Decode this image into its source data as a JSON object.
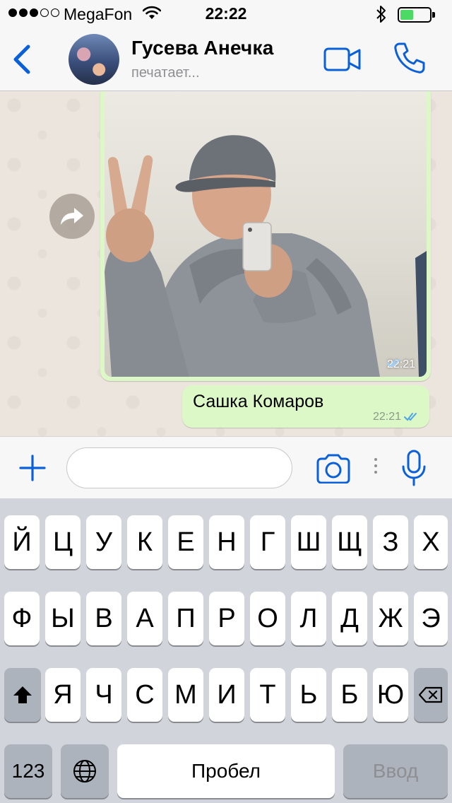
{
  "status_bar": {
    "carrier": "MegaFon",
    "time": "22:22",
    "signal_bars_filled": 3,
    "signal_bars_total": 5,
    "battery_level": 0.45,
    "battery_color": "#4cd964"
  },
  "header": {
    "contact_name": "Гусева Анечка",
    "contact_status": "печатает...",
    "accent_color": "#0a60d8"
  },
  "messages": [
    {
      "type": "image",
      "time": "22:21",
      "status": "read"
    },
    {
      "type": "text",
      "text": "Сашка Комаров",
      "time": "22:21",
      "status": "read"
    }
  ],
  "composer": {
    "placeholder": ""
  },
  "keyboard": {
    "row1": [
      "Й",
      "Ц",
      "У",
      "К",
      "Е",
      "Н",
      "Г",
      "Ш",
      "Щ",
      "З",
      "Х"
    ],
    "row2": [
      "Ф",
      "Ы",
      "В",
      "А",
      "П",
      "Р",
      "О",
      "Л",
      "Д",
      "Ж",
      "Э"
    ],
    "row3": [
      "Я",
      "Ч",
      "С",
      "М",
      "И",
      "Т",
      "Ь",
      "Б",
      "Ю"
    ],
    "numbers_label": "123",
    "space_label": "Пробел",
    "return_label": "Ввод"
  }
}
